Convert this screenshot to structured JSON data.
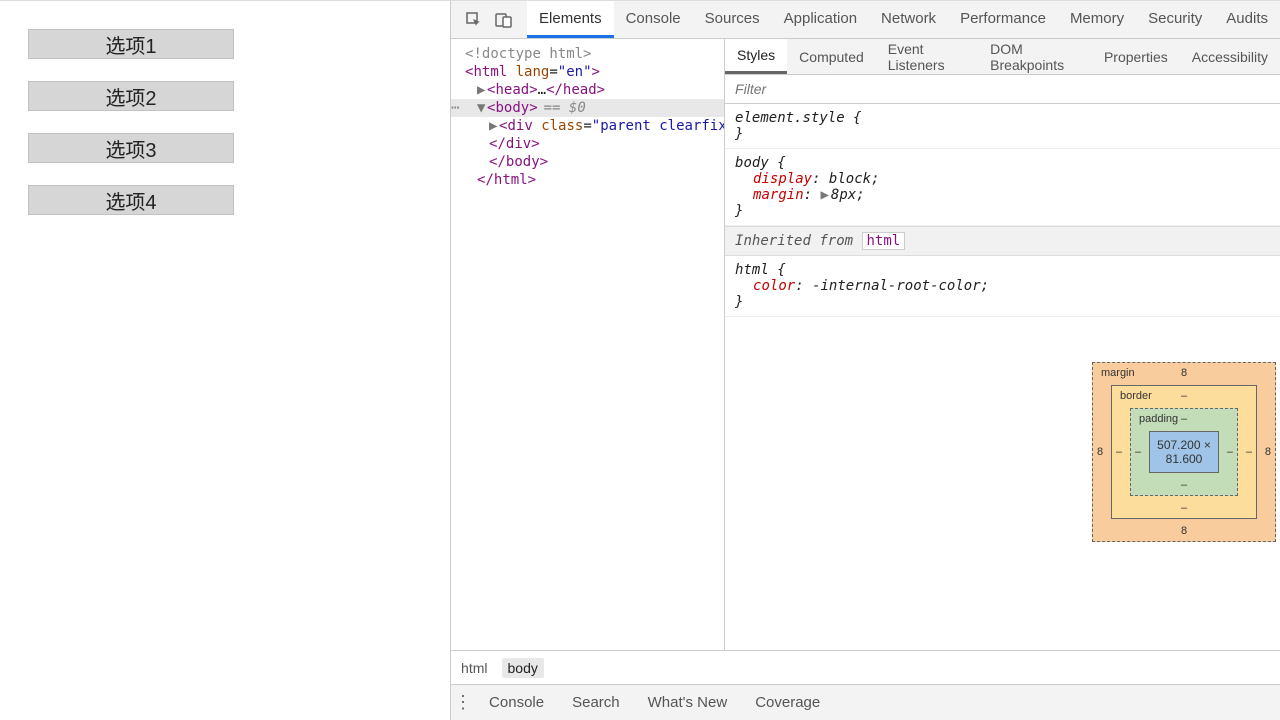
{
  "viewport": {
    "options": [
      "选项1",
      "选项2",
      "选项3",
      "选项4"
    ]
  },
  "devtools": {
    "tabs": [
      "Elements",
      "Console",
      "Sources",
      "Application",
      "Network",
      "Performance",
      "Memory",
      "Security",
      "Audits"
    ],
    "active_tab": "Elements",
    "subtabs": [
      "Styles",
      "Computed",
      "Event Listeners",
      "DOM Breakpoints",
      "Properties",
      "Accessibility"
    ],
    "active_subtab": "Styles",
    "filter_placeholder": "Filter",
    "dom": {
      "doctype": "<!doctype html>",
      "html_open": "<html lang=\"en\">",
      "head": "<head>…</head>",
      "body_open": "<body>",
      "body_eq": "== $0",
      "div_open": "<div class=\"parent clearfix\">…",
      "div_close": "</div>",
      "body_close": "</body>",
      "html_close": "</html>"
    },
    "styles_rules": {
      "element_style_sel": "element.style {",
      "body_sel": "body {",
      "body_props": [
        {
          "name": "display",
          "value": "block;"
        },
        {
          "name": "margin",
          "value": "8px;",
          "tri": true
        }
      ],
      "inherited_label": "Inherited from",
      "inherited_tag": "html",
      "html_sel": "html {",
      "html_props": [
        {
          "name": "color",
          "value": "-internal-root-color;"
        }
      ],
      "close_brace": "}"
    },
    "boxmodel": {
      "margin_label": "margin",
      "border_label": "border",
      "padding_label": "padding",
      "margin_vals": {
        "t": "8",
        "r": "8",
        "b": "8",
        "l": "8"
      },
      "border_vals": {
        "t": "–",
        "r": "–",
        "b": "–",
        "l": "–"
      },
      "padding_vals": {
        "t": "–",
        "r": "–",
        "b": "–",
        "l": "–"
      },
      "content": "507.200 × 81.600"
    },
    "crumbs": [
      "html",
      "body"
    ],
    "drawer_tabs": [
      "Console",
      "Search",
      "What's New",
      "Coverage"
    ]
  }
}
